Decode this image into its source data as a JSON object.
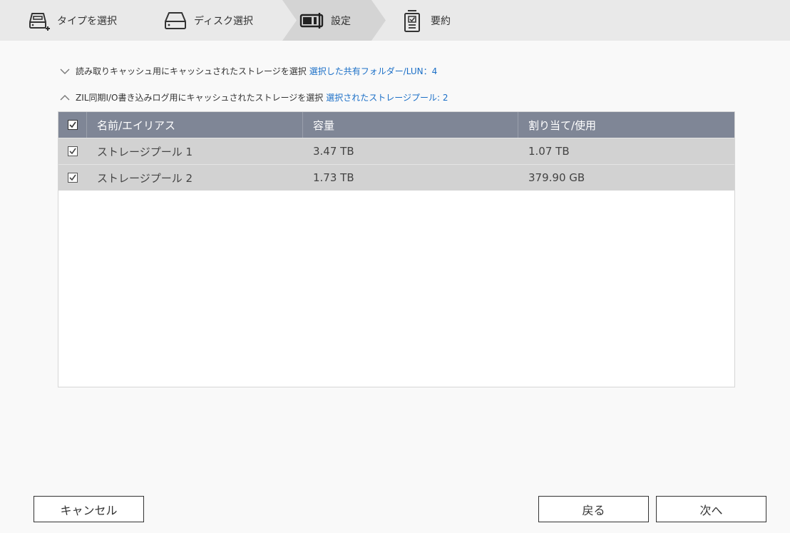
{
  "steps": [
    {
      "label": "タイプを選択",
      "icon": "drive-add-icon"
    },
    {
      "label": "ディスク選択",
      "icon": "disk-icon"
    },
    {
      "label": "設定",
      "icon": "settings-icon"
    },
    {
      "label": "要約",
      "icon": "summary-clipboard-icon"
    }
  ],
  "colors": {
    "stepbar_bg": "#e9e9e9",
    "active_step_bg": "#d4d4d4",
    "link": "#1b6fc7",
    "table_header_bg": "#7f8696",
    "row_bg": "#d2d2d2"
  },
  "sections": {
    "read_cache": {
      "label": "読み取りキャッシュ用にキャッシュされたストレージを選択",
      "link": "選択した共有フォルダー/LUN：4",
      "expanded": false
    },
    "zil_cache": {
      "label": "ZIL同期I/O書き込みログ用にキャッシュされたストレージを選択",
      "link": "選択されたストレージプール: 2",
      "expanded": true
    }
  },
  "table": {
    "columns": [
      "名前/エイリアス",
      "容量",
      "割り当て/使用"
    ],
    "select_all_checked": true,
    "rows": [
      {
        "checked": true,
        "name": "ストレージプール 1",
        "capacity": "3.47 TB",
        "allocated": "1.07 TB"
      },
      {
        "checked": true,
        "name": "ストレージプール 2",
        "capacity": "1.73 TB",
        "allocated": "379.90 GB"
      }
    ]
  },
  "buttons": {
    "cancel": "キャンセル",
    "back": "戻る",
    "next": "次へ"
  }
}
